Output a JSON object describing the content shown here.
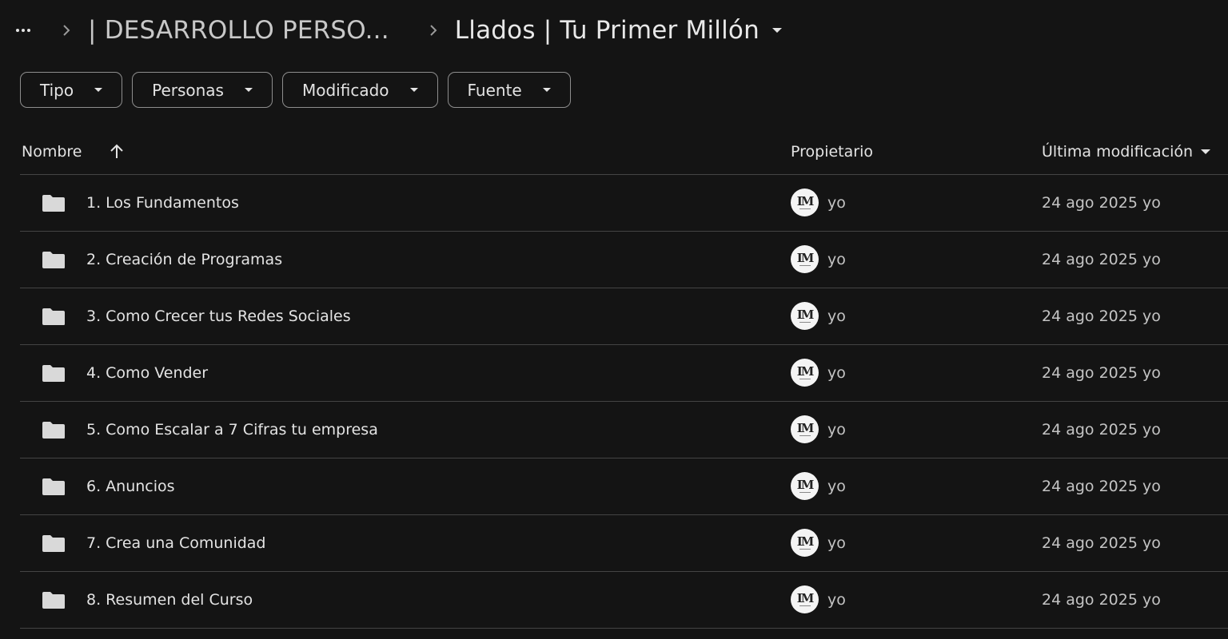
{
  "breadcrumb": {
    "parent": "| DESARROLLO PERSO...",
    "current": "Llados | Tu Primer Millón"
  },
  "filters": [
    "Tipo",
    "Personas",
    "Modificado",
    "Fuente"
  ],
  "columns": {
    "name": "Nombre",
    "owner": "Propietario",
    "modified": "Última modificación"
  },
  "rows": [
    {
      "name": "1. Los Fundamentos",
      "owner": "yo",
      "modified": "24 ago 2025 yo"
    },
    {
      "name": "2. Creación de Programas",
      "owner": "yo",
      "modified": "24 ago 2025 yo"
    },
    {
      "name": "3. Como Crecer tus Redes Sociales",
      "owner": "yo",
      "modified": "24 ago 2025 yo"
    },
    {
      "name": "4. Como Vender",
      "owner": "yo",
      "modified": "24 ago 2025 yo"
    },
    {
      "name": "5. Como Escalar a 7 Cifras tu empresa",
      "owner": "yo",
      "modified": "24 ago 2025 yo"
    },
    {
      "name": "6. Anuncios",
      "owner": "yo",
      "modified": "24 ago 2025 yo"
    },
    {
      "name": "7. Crea una Comunidad",
      "owner": "yo",
      "modified": "24 ago 2025 yo"
    },
    {
      "name": "8. Resumen del Curso",
      "owner": "yo",
      "modified": "24 ago 2025 yo"
    }
  ]
}
